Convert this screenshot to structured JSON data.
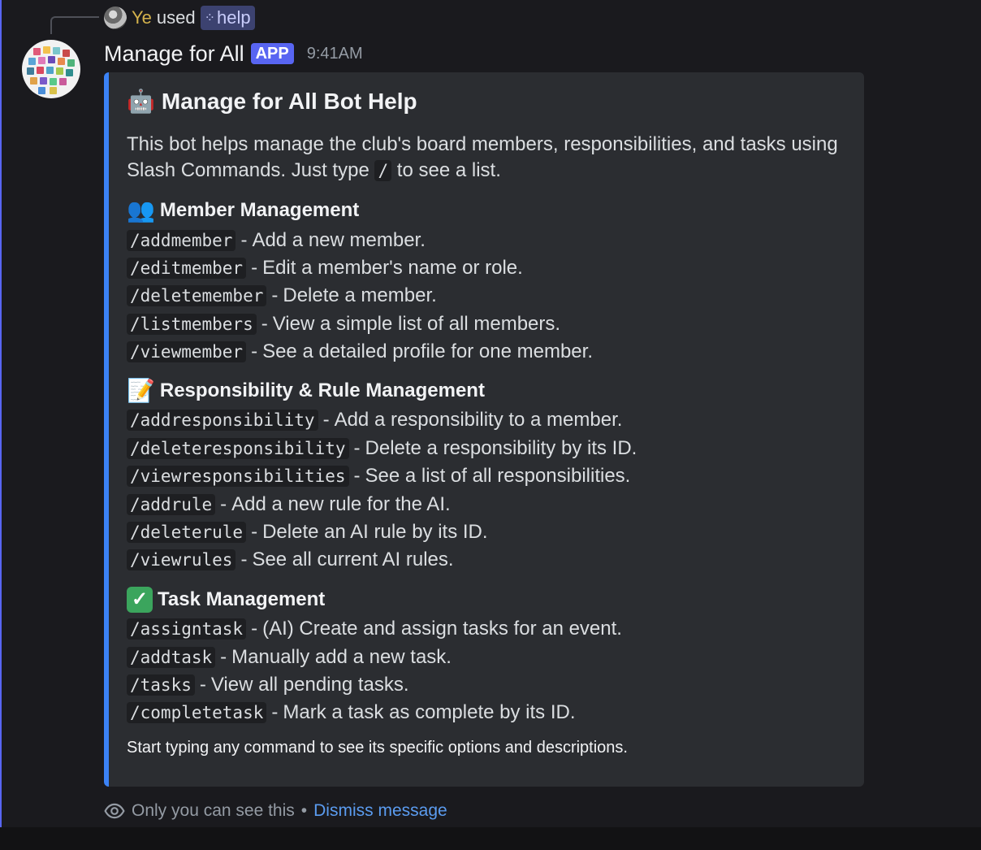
{
  "reply": {
    "user": "Ye",
    "used_text": "used",
    "command": "help",
    "command_icon": "slash-command-icon"
  },
  "message": {
    "author": "Manage for All",
    "badge": "APP",
    "timestamp": "9:41AM"
  },
  "embed": {
    "accent_color": "#3b82f6",
    "title_icon": "robot-emoji",
    "title": "Manage for All Bot Help",
    "description_before": "This bot helps manage the club's board members, responsibilities, and tasks using Slash Commands. Just type",
    "description_code": "/",
    "description_after": "to see a list.",
    "sections": [
      {
        "icon": "busts-in-silhouette-emoji",
        "title": "Member Management",
        "commands": [
          {
            "cmd": "/addmember",
            "desc": "Add a new member."
          },
          {
            "cmd": "/editmember",
            "desc": "Edit a member's name or role."
          },
          {
            "cmd": "/deletemember",
            "desc": "Delete a member."
          },
          {
            "cmd": "/listmembers",
            "desc": "View a simple list of all members."
          },
          {
            "cmd": "/viewmember",
            "desc": "See a detailed profile for one member."
          }
        ]
      },
      {
        "icon": "memo-emoji",
        "title": "Responsibility & Rule Management",
        "commands": [
          {
            "cmd": "/addresponsibility",
            "desc": "Add a responsibility to a member."
          },
          {
            "cmd": "/deleteresponsibility",
            "desc": "Delete a responsibility by its ID."
          },
          {
            "cmd": "/viewresponsibilities",
            "desc": "See a list of all responsibilities."
          },
          {
            "cmd": "/addrule",
            "desc": "Add a new rule for the AI."
          },
          {
            "cmd": "/deleterule",
            "desc": "Delete an AI rule by its ID."
          },
          {
            "cmd": "/viewrules",
            "desc": "See all current AI rules."
          }
        ]
      },
      {
        "icon": "check-mark-button-emoji",
        "title": "Task Management",
        "commands": [
          {
            "cmd": "/assigntask",
            "desc": "(AI) Create and assign tasks for an event."
          },
          {
            "cmd": "/addtask",
            "desc": "Manually add a new task."
          },
          {
            "cmd": "/tasks",
            "desc": "View all pending tasks."
          },
          {
            "cmd": "/completetask",
            "desc": "Mark a task as complete by its ID."
          }
        ]
      }
    ],
    "footer": "Start typing any command to see its specific options and descriptions."
  },
  "ephemeral": {
    "icon": "eye-icon",
    "text": "Only you can see this",
    "separator": "•",
    "dismiss": "Dismiss message"
  }
}
